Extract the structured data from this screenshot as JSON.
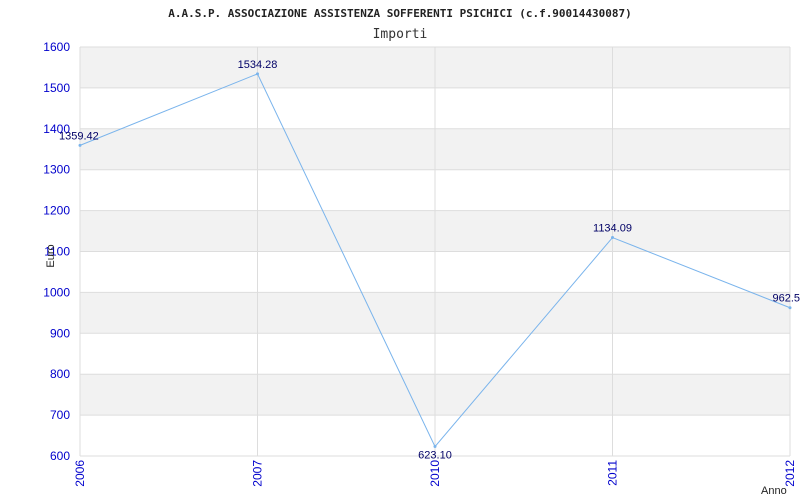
{
  "chart_data": {
    "type": "line",
    "title": "A.A.S.P. ASSOCIAZIONE ASSISTENZA SOFFERENTI PSICHICI (c.f.90014430087)",
    "subtitle": "Importi",
    "xlabel": "Anno",
    "ylabel": "Euro",
    "x": [
      "2006",
      "2007",
      "2010",
      "2011",
      "2012"
    ],
    "values": [
      1359.42,
      1534.28,
      623.1,
      1134.09,
      962.5
    ],
    "value_labels": [
      "1359.42",
      "1534.28",
      "623.10",
      "1134.09",
      "962.5"
    ],
    "ylim": [
      600,
      1600
    ],
    "yticks": [
      "600",
      "700",
      "800",
      "900",
      "1000",
      "1100",
      "1200",
      "1300",
      "1400",
      "1500",
      "1600"
    ],
    "grid": true,
    "colors": {
      "line": "#7ab4ec",
      "band": "#f2f2f2",
      "grid": "#dddddd",
      "tick": "#0000cc",
      "label": "#000066"
    }
  }
}
